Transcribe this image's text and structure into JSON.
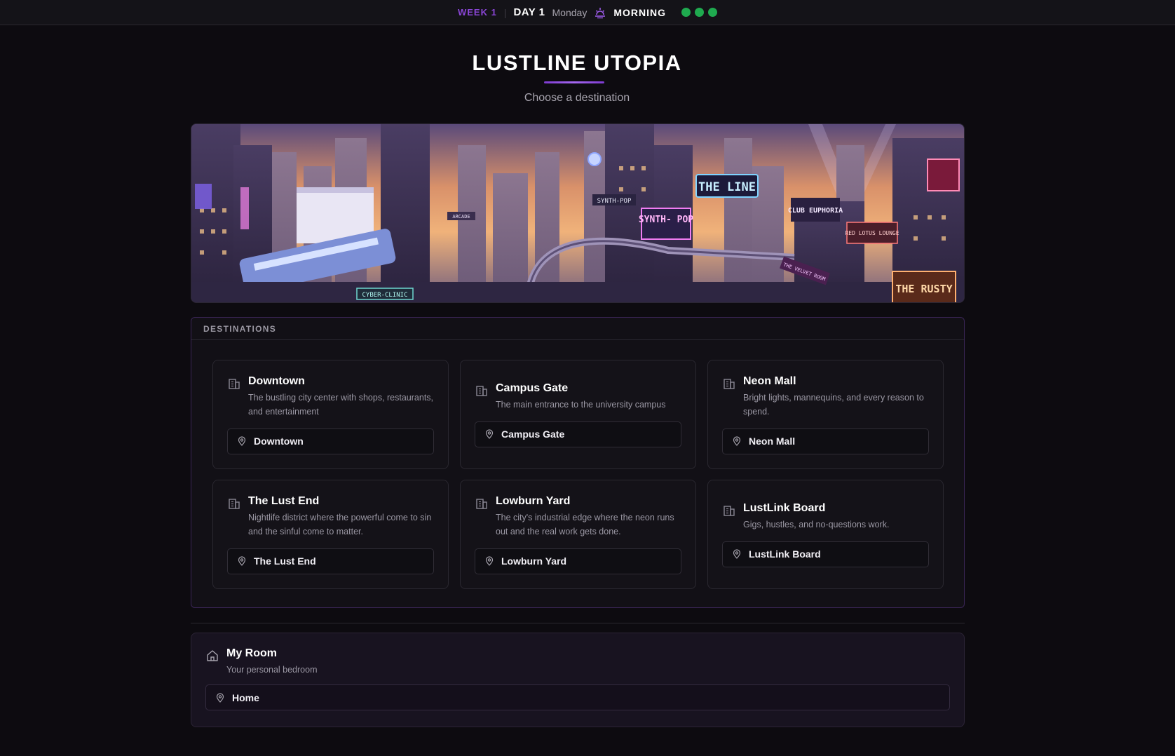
{
  "status": {
    "week": "WEEK 1",
    "day": "DAY 1",
    "weekday": "Monday",
    "period": "MORNING",
    "period_icon": "sunrise-icon",
    "indicators": [
      "green",
      "green",
      "green"
    ],
    "indicator_color": "#1faa4f"
  },
  "header": {
    "title": "LUSTLINE UTOPIA",
    "subtitle": "Choose a destination"
  },
  "banner": {
    "signs": [
      "THE LINE",
      "SYNTH-POP",
      "SYNTH- POP",
      "CLUB EUPHORIA",
      "RED LOTUS LOUNGE",
      "CYBER-CLINIC",
      "THE RUSTY",
      "ARCADE",
      "THE VELVET ROOM"
    ]
  },
  "destinations": {
    "heading": "DESTINATIONS",
    "items": [
      {
        "title": "Downtown",
        "description": "The bustling city center with shops, restaurants, and entertainment",
        "button": "Downtown"
      },
      {
        "title": "Campus Gate",
        "description": "The main entrance to the university campus",
        "button": "Campus Gate"
      },
      {
        "title": "Neon Mall",
        "description": "Bright lights, mannequins, and every reason to spend.",
        "button": "Neon Mall"
      },
      {
        "title": "The Lust End",
        "description": "Nightlife district where the powerful come to sin and the sinful come to matter.",
        "button": "The Lust End"
      },
      {
        "title": "Lowburn Yard",
        "description": "The city's industrial edge where the neon runs out and the real work gets done.",
        "button": "Lowburn Yard"
      },
      {
        "title": "LustLink Board",
        "description": "Gigs, hustles, and no-questions work.",
        "button": "LustLink Board"
      }
    ]
  },
  "room": {
    "title": "My Room",
    "description": "Your personal bedroom",
    "button": "Home"
  },
  "colors": {
    "accent": "#8a45d6",
    "background": "#0d0b10",
    "panel_border": "#3a2556"
  }
}
